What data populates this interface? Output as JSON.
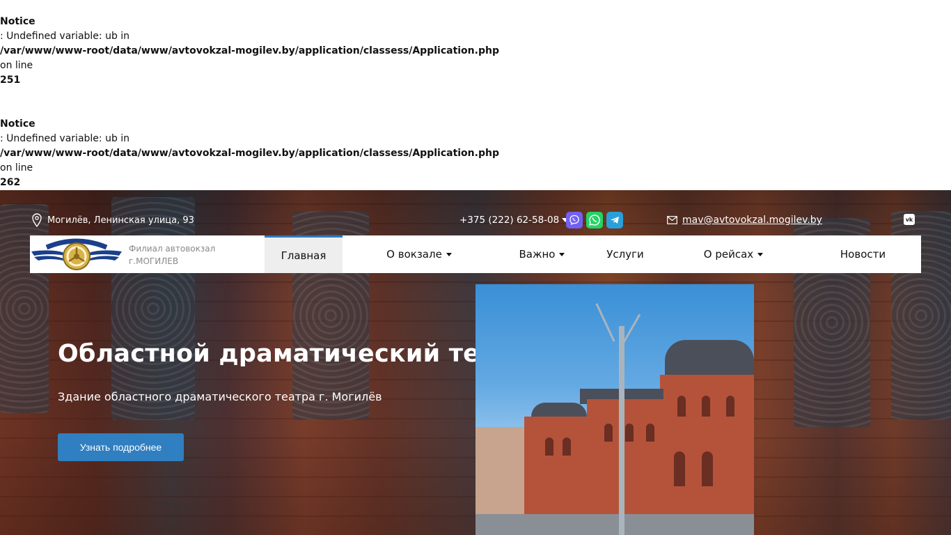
{
  "notices": [
    {
      "type": "Notice",
      "message": ": Undefined variable: ub in",
      "path": "/var/www/www-root/data/www/avtovokzal-mogilev.by/application/classess/Application.php",
      "on_line": "on line",
      "line": "251"
    },
    {
      "type": "Notice",
      "message": ": Undefined variable: ub in",
      "path": "/var/www/www-root/data/www/avtovokzal-mogilev.by/application/classess/Application.php",
      "on_line": "on line",
      "line": "262"
    }
  ],
  "topbar": {
    "address": "Могилёв, Ленинская улица, 93",
    "phone": "+375 (222) 62-58-08",
    "email": "mav@avtovokzal.mogilev.by",
    "messengers": [
      "viber-icon",
      "whatsapp-icon",
      "telegram-icon"
    ],
    "social": "vk-icon"
  },
  "brand": {
    "line1": "Филиал автовокзал",
    "line2": "г.МОГИЛЕВ"
  },
  "menu": [
    {
      "label": "Главная",
      "active": true
    },
    {
      "label": "О вокзале",
      "dropdown": true
    },
    {
      "label": "Важно",
      "dropdown": true
    },
    {
      "label": "Услуги"
    },
    {
      "label": "О рейсах",
      "dropdown": true
    },
    {
      "label": "Новости"
    }
  ],
  "hero": {
    "title": "Областной драматический театр",
    "subtitle": "Здание областного драматического театра г. Могилёв",
    "button": "Узнать подробнее"
  },
  "colors": {
    "accent": "#2f7fc1",
    "viber": "#7360f2",
    "whatsapp": "#25d366",
    "telegram": "#2aa0da"
  }
}
